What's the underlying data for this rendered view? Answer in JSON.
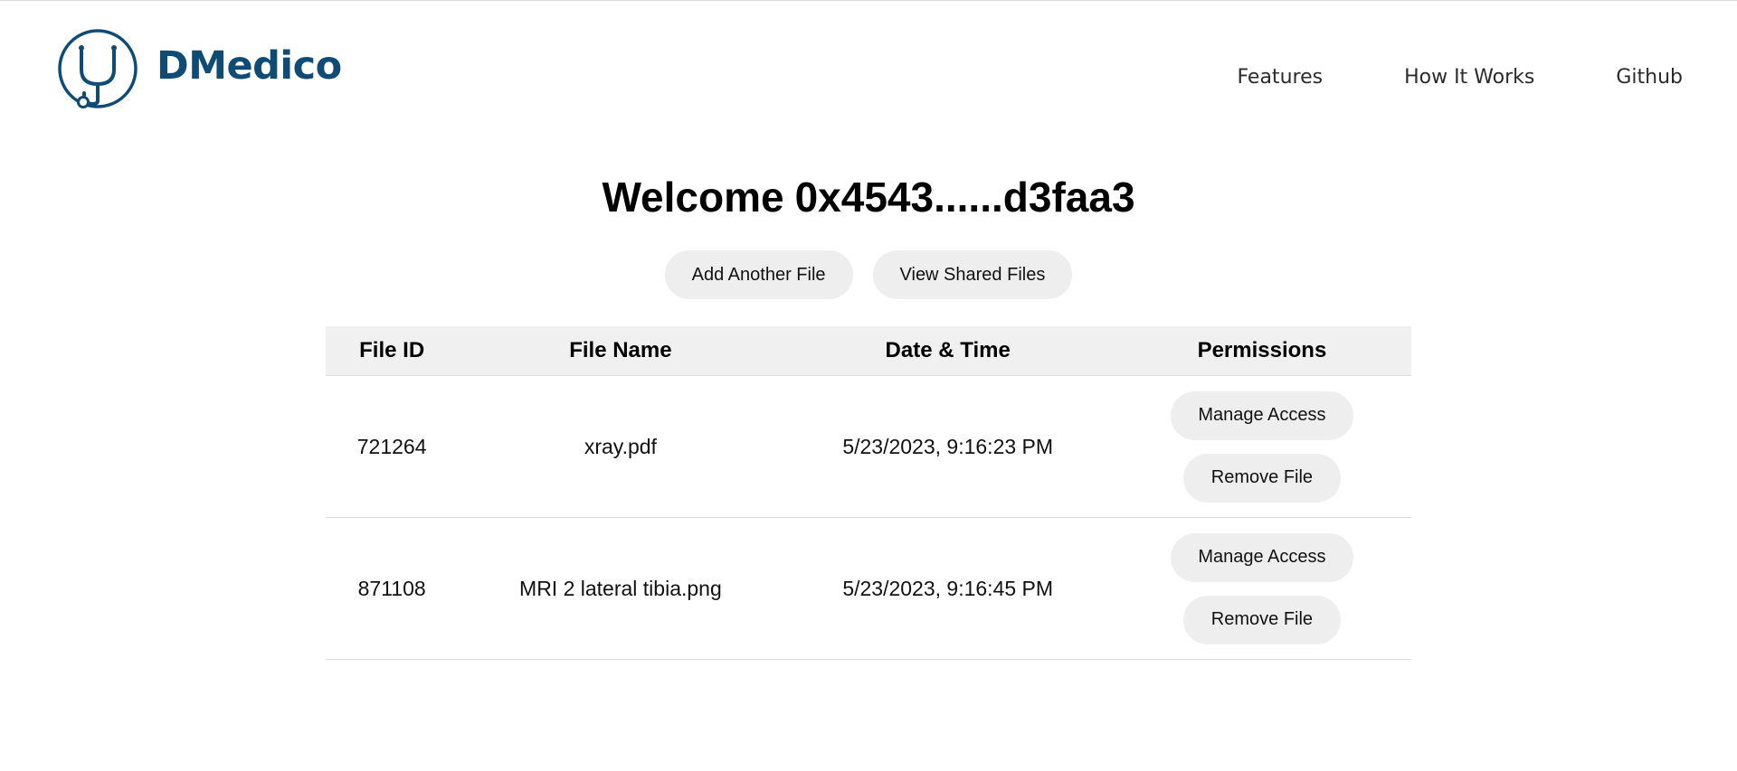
{
  "brand": {
    "name": "DMedico",
    "logo_icon": "stethoscope-icon",
    "color": "#0f4c75"
  },
  "nav": {
    "items": [
      {
        "label": "Features"
      },
      {
        "label": "How It Works"
      },
      {
        "label": "Github"
      }
    ]
  },
  "main": {
    "welcome_prefix": "Welcome",
    "wallet_address": "0x4543......d3faa3",
    "add_file_label": "Add Another File",
    "view_shared_label": "View Shared Files"
  },
  "table": {
    "headers": {
      "file_id": "File ID",
      "file_name": "File Name",
      "date_time": "Date & Time",
      "permissions": "Permissions"
    },
    "rows": [
      {
        "file_id": "721264",
        "file_name": "xray.pdf",
        "date_time": "5/23/2023, 9:16:23 PM",
        "manage_label": "Manage Access",
        "remove_label": "Remove File"
      },
      {
        "file_id": "871108",
        "file_name": "MRI 2 lateral tibia.png",
        "date_time": "5/23/2023, 9:16:45 PM",
        "manage_label": "Manage Access",
        "remove_label": "Remove File"
      }
    ]
  }
}
